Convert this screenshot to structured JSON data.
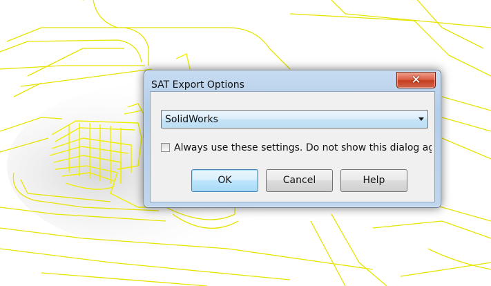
{
  "dialog": {
    "title": "SAT Export Options",
    "close_icon": "close-icon",
    "format_select": {
      "value": "SolidWorks",
      "arrow_icon": "chevron-down-icon"
    },
    "remember_checkbox": {
      "checked": false,
      "label": "Always use these settings. Do not show this dialog agai"
    },
    "buttons": {
      "ok": "OK",
      "cancel": "Cancel",
      "help": "Help"
    }
  },
  "background": {
    "wireframe_color": "#e8e600"
  }
}
